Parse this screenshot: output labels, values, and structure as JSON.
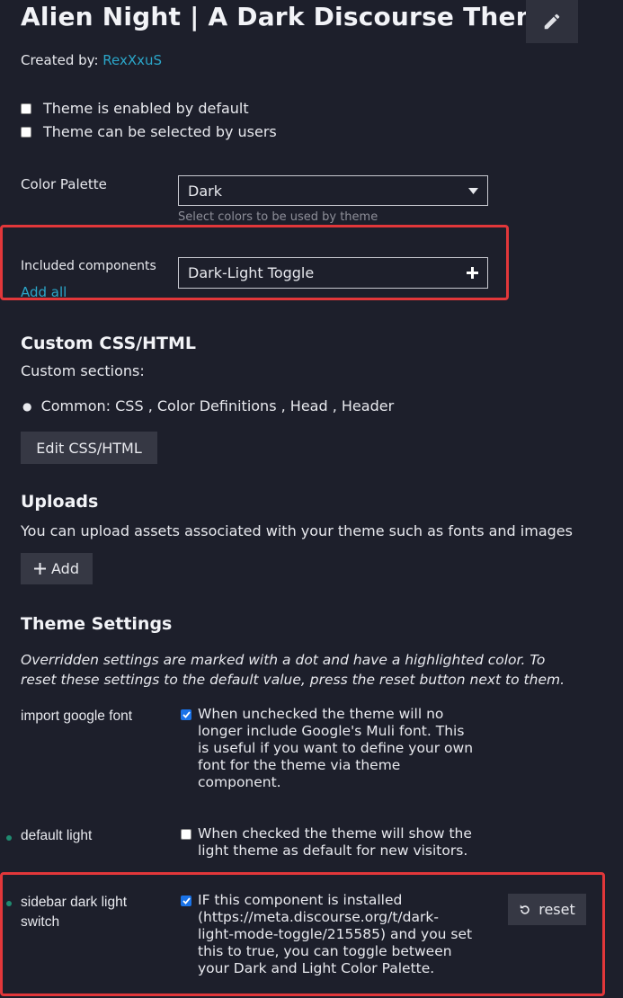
{
  "header": {
    "title": "Alien Night | A Dark Discourse Theme",
    "created_by_label": "Created by:",
    "author": "RexXxuS",
    "edit_icon": "pencil-icon"
  },
  "options": {
    "enabled_default": {
      "label": "Theme is enabled by default",
      "checked": false
    },
    "selectable": {
      "label": "Theme can be selected by users",
      "checked": false
    }
  },
  "color_palette": {
    "label": "Color Palette",
    "value": "Dark",
    "hint": "Select colors to be used by theme"
  },
  "components": {
    "label": "Included components",
    "value": "Dark-Light Toggle",
    "add_all": "Add all"
  },
  "custom_css": {
    "title": "Custom CSS/HTML",
    "sections_label": "Custom sections:",
    "sections_item": "Common: CSS , Color Definitions , Head , Header",
    "edit_button": "Edit CSS/HTML"
  },
  "uploads": {
    "title": "Uploads",
    "description": "You can upload assets associated with your theme such as fonts and images",
    "add_button": "Add"
  },
  "theme_settings": {
    "title": "Theme Settings",
    "note_line1": "Overridden settings are marked with a dot and have a highlighted color. To",
    "note_line2": "reset these settings to the default value, press the reset button next to them.",
    "settings": [
      {
        "name": "import google font",
        "checked": true,
        "overridden": false,
        "desc_lines": [
          "When unchecked the theme will no",
          "longer include Google's Muli font. This",
          "is useful if you want to define your own",
          "font for the theme via theme",
          "component."
        ]
      },
      {
        "name": "default light",
        "checked": false,
        "overridden": true,
        "desc_lines": [
          "When checked the theme will show the",
          "light theme as default for new visitors."
        ]
      },
      {
        "name_lines": [
          "sidebar dark light",
          "switch"
        ],
        "checked": true,
        "overridden": true,
        "desc_lines": [
          "IF this component is installed",
          "(https://meta.discourse.org/t/dark-",
          "light-mode-toggle/215585) and you set",
          "this to true, you can toggle between",
          "your Dark and Light Color Palette."
        ],
        "reset_label": "reset"
      }
    ]
  },
  "colors": {
    "background": "#1d1f2b",
    "accent_link": "#2ba6c9",
    "highlight_border": "#e2373a",
    "checkbox_checked": "#1a73e8",
    "overridden_dot": "#1f8a70"
  }
}
